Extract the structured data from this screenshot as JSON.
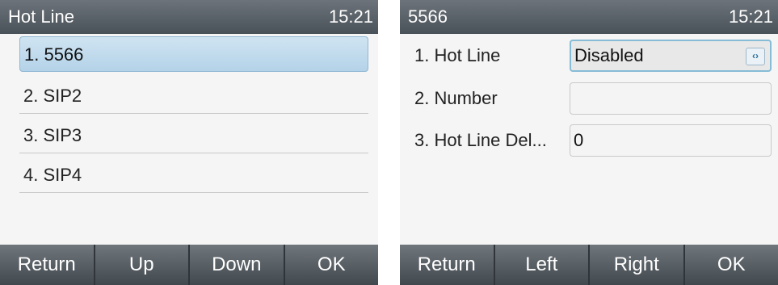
{
  "left": {
    "title": "Hot Line",
    "time": "15:21",
    "items": [
      {
        "label": "1. 5566"
      },
      {
        "label": "2. SIP2"
      },
      {
        "label": "3. SIP3"
      },
      {
        "label": "4. SIP4"
      }
    ],
    "softkeys": [
      "Return",
      "Up",
      "Down",
      "OK"
    ]
  },
  "right": {
    "title": "5566",
    "time": "15:21",
    "rows": [
      {
        "label": "1.  Hot Line",
        "value": "Disabled"
      },
      {
        "label": "2.  Number",
        "value": ""
      },
      {
        "label": "3.  Hot Line Del...",
        "value": "0"
      }
    ],
    "arrow_glyph": "‹›",
    "softkeys": [
      "Return",
      "Left",
      "Right",
      "OK"
    ]
  },
  "colors": {
    "titlebar": "#5b6269",
    "selection": "#c3dcee",
    "focus_border": "#86bcd6"
  }
}
